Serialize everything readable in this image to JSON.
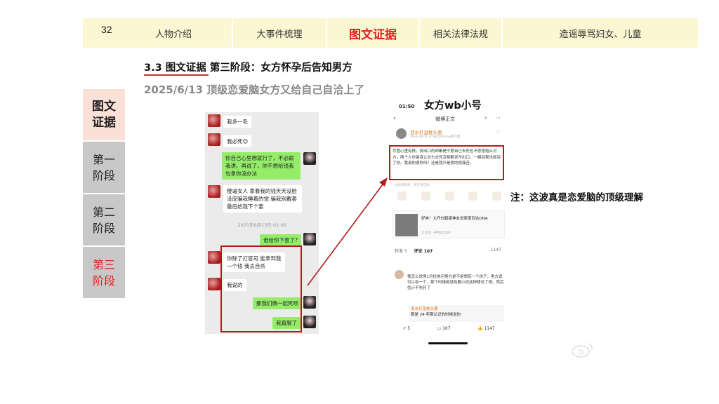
{
  "page_number": "32",
  "topnav": {
    "tabs": [
      {
        "label": "人物介绍"
      },
      {
        "label": "大事件梳理"
      },
      {
        "label": "图文证据"
      },
      {
        "label": "相关法律法规"
      },
      {
        "label": "造谣辱骂妇女、儿童"
      }
    ],
    "active_index": 2
  },
  "sidebar": {
    "items": [
      {
        "line1": "图文",
        "line2": "证据"
      },
      {
        "line1": "第一",
        "line2": "阶段"
      },
      {
        "line1": "第二",
        "line2": "阶段"
      },
      {
        "line1": "第三",
        "line2": "阶段"
      }
    ]
  },
  "section_title": "3.3 图文证据 第三阶段：女方怀孕后告知男方",
  "subtitle": "2025/6/13 顶级恋爱脑女方又给自己自洽上了",
  "chat": {
    "messages": [
      {
        "side": "left",
        "text": "我多一毛"
      },
      {
        "side": "left",
        "text": "我必死😊"
      },
      {
        "side": "right",
        "text": "你自己心里想就行了，不必跟我讲。再说了，你不想给钱我也拿你没办法"
      },
      {
        "side": "left",
        "text": "傻逼女人 拿着我的钱天天没脸没皮骗我睡着的觉 骗我别戴套 最后给我下个套"
      },
      {
        "side": "right",
        "text": "谁给你下套了?"
      },
      {
        "side": "left",
        "text": "你除了打官司 能拿到我一个钱 我去自杀"
      },
      {
        "side": "left",
        "text": "我说的"
      },
      {
        "side": "right",
        "text": "那我们俩一起死呗"
      },
      {
        "side": "right",
        "text": "我真服了"
      }
    ],
    "timestamp": "2025年6月13日 02:06"
  },
  "weibo": {
    "caption": "女方wb小号",
    "status_time": "01:50",
    "nav_title": "微博正文",
    "user": "泪水打湿枕头要",
    "meta": "26-6-28 01:30 来自iPhone客户端",
    "post": "尽管心里有恨。说出口的却都是宁愿自己去死也不愿意赔从对方，两个人吵架连让对方去死互相都说不出口，一瞬间我也原谅了你。我真的很你吗？还是我只是爱的很痛苦。",
    "source": "此贴来来源：我在来自微",
    "card_title": "好奔！大乔白鹤梁神女进原度到达DNA",
    "card_sub": "乒乓球 · 神秀的奔跑！",
    "tab_repost": "转发 5",
    "tab_comment": "评论 107",
    "likes": "1147",
    "comment": "我怎么觉得1月份他问男方是不是想有一个孩子，男方说可以有一个，那个时候她就有要小孩这种想法了吧。然后估计不吃药了",
    "reply_name": "泪水打湿枕头要",
    "reply_text": "那是 24 年刚认识的时候说的",
    "bottom_repost": "5",
    "bottom_comment": "107",
    "bottom_like": "1147"
  },
  "note": "注：这波真是恋爱脑的顶级理解",
  "colors": {
    "nav_bg": "#fcf7d3",
    "accent_red": "#e0211f",
    "box_red": "#b01c1c",
    "sidebar_active": "#fbe0d8",
    "sidebar_gray": "#c8c8c8"
  }
}
